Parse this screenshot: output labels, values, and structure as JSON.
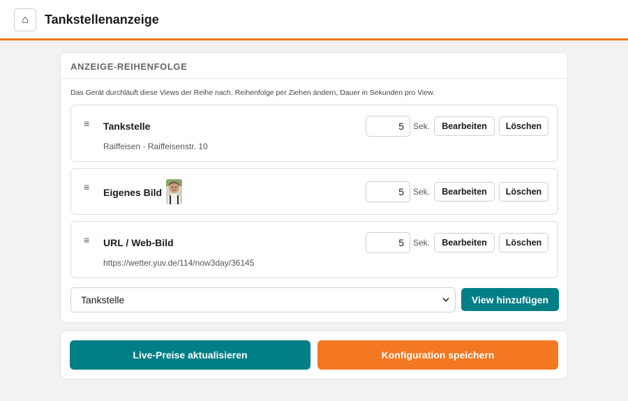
{
  "header": {
    "home_icon": "⌂",
    "title": "Tankstellenanzeige",
    "accent_color": "#f47721"
  },
  "order_section": {
    "title": "ANZEIGE-REIHENFOLGE",
    "hint": "Das Gerät durchläuft diese Views der Reihe nach. Reihenfolge per Ziehen ändern, Dauer in Sekunden pro View.",
    "drag_handle": "≡",
    "unit_label": "Sek.",
    "edit_label": "Bearbeiten",
    "delete_label": "Löschen",
    "items": [
      {
        "title": "Tankstelle",
        "subtitle": "Raiffeisen · Raiffeisenstr. 10",
        "duration": "5"
      },
      {
        "title": "Eigenes Bild",
        "thumbnail": "child-photo",
        "duration": "5"
      },
      {
        "title": "URL / Web-Bild",
        "subtitle": "https://wetter.yuv.de/114/now3day/36145",
        "duration": "5"
      }
    ],
    "view_select": {
      "selected": "Tankstelle",
      "icon": "chevron-down-icon"
    },
    "add_view_label": "View hinzufügen"
  },
  "actions": {
    "refresh_label": "Live-Preise aktualisieren",
    "save_label": "Konfiguration speichern",
    "primary_color": "#007f86",
    "secondary_color": "#f47721"
  }
}
